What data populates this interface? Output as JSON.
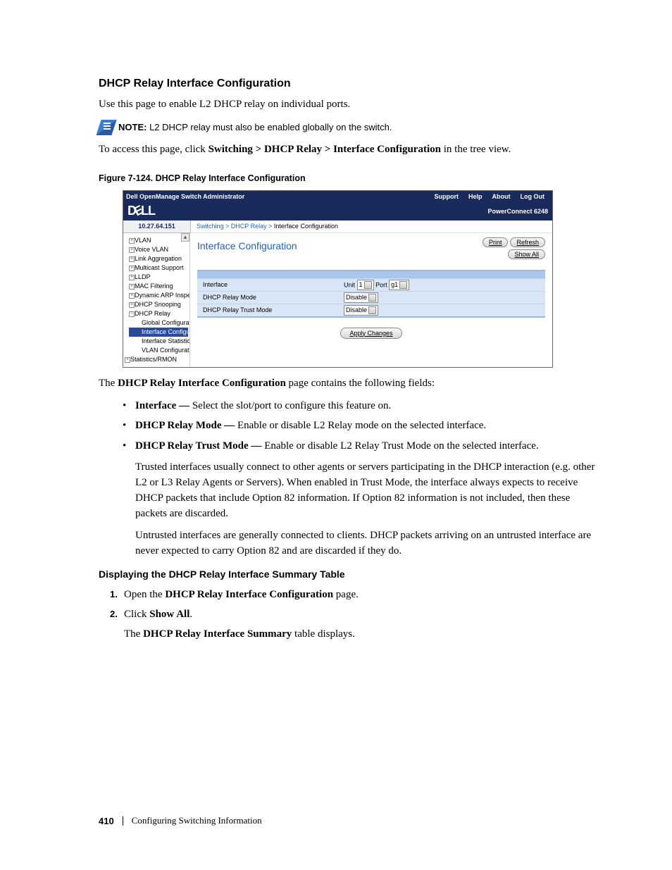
{
  "heading": "DHCP Relay Interface Configuration",
  "p1": "Use this page to enable L2 DHCP relay on individual ports.",
  "note": {
    "label": "NOTE:",
    "text": " L2 DHCP relay must also be enabled globally on the switch."
  },
  "p2_a": "To access this page, click ",
  "p2_b": "Switching > DHCP Relay > Interface Configuration",
  "p2_c": " in the tree view.",
  "figcap": "Figure 7-124.    DHCP Relay Interface Configuration",
  "shot": {
    "title": "Dell OpenManage Switch Administrator",
    "nav": {
      "support": "Support",
      "help": "Help",
      "about": "About",
      "logout": "Log Out"
    },
    "logo": "D LL",
    "model": "PowerConnect 6248",
    "ip": "10.27.64.151",
    "crumb_a": "Switching",
    "crumb_b": "DHCP Relay",
    "crumb_c": "Interface Configuration",
    "tree": {
      "vlan": "VLAN",
      "voice": "Voice VLAN",
      "link": "Link Aggregation",
      "mcast": "Multicast Support",
      "lldp": "LLDP",
      "mac": "MAC Filtering",
      "darp": "Dynamic ARP Inspe",
      "snoop": "DHCP Snooping",
      "relay": "DHCP Relay",
      "sub1": "Global Configurat",
      "sub2": "Interface Configu",
      "sub3": "Interface Statistic",
      "sub4": "VLAN Configurati",
      "stats": "Statistics/RMON"
    },
    "content": {
      "title": "Interface Configuration",
      "print": "Print",
      "refresh": "Refresh",
      "showall": "Show All",
      "row1": "Interface",
      "row1_unit": "Unit",
      "row1_unitv": "1",
      "row1_port": "Port",
      "row1_portv": "g1",
      "row2": "DHCP Relay Mode",
      "row2v": "Disable",
      "row3": "DHCP Relay Trust Mode",
      "row3v": "Disable",
      "apply": "Apply Changes"
    }
  },
  "after_shot_a": "The ",
  "after_shot_b": "DHCP Relay Interface Configuration",
  "after_shot_c": " page contains the following fields:",
  "bul1_b": "Interface — ",
  "bul1_t": "Select the slot/port to configure this feature on.",
  "bul2_b": "DHCP Relay Mode — ",
  "bul2_t": "Enable or disable L2 Relay mode on the selected interface.",
  "bul3_b": "DHCP Relay Trust Mode — ",
  "bul3_t": "Enable or disable L2 Relay Trust Mode on the selected interface.",
  "bul3_p1": "Trusted interfaces usually connect to other agents or servers participating in the DHCP interaction (e.g. other L2 or L3 Relay Agents or Servers). When enabled in Trust Mode, the interface always expects to receive DHCP packets that include Option 82 information. If Option 82 information is not included, then these packets are discarded.",
  "bul3_p2": "Untrusted interfaces are generally connected to clients. DHCP packets arriving on an untrusted interface are never expected to carry Option 82 and are discarded if they do.",
  "sect": "Displaying the DHCP Relay Interface Summary Table",
  "s1_a": "Open the ",
  "s1_b": "DHCP Relay Interface Configuration",
  "s1_c": " page.",
  "s2_a": "Click ",
  "s2_b": "Show All",
  "s2_c": ".",
  "s2_sub_a": "The ",
  "s2_sub_b": "DHCP Relay Interface Summary",
  "s2_sub_c": " table displays.",
  "footer": {
    "page": "410",
    "text": "Configuring Switching Information"
  }
}
